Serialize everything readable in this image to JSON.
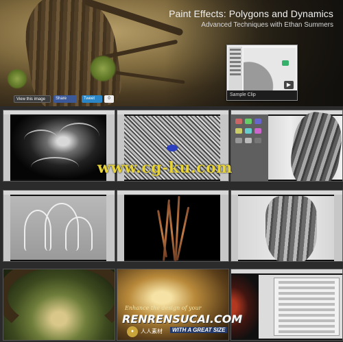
{
  "header": {
    "title": "Paint Effects: Polygons and Dynamics",
    "subtitle": "Advanced Techniques with Ethan Summers"
  },
  "sample": {
    "caption": "Sample Clip",
    "play_icon": "play-icon"
  },
  "social": {
    "view_image": "View this image",
    "share": "Share",
    "tweet": "Tweet",
    "count": "0"
  },
  "watermark": {
    "text": "www.cg-ku.com",
    "line1": "Enhance the design of your",
    "line2": "RENRENSUCAI.COM",
    "line3": "人人素材",
    "line4": "WITH A GREAT SIZE"
  },
  "colors": {
    "watermark_yellow": "#e6d23a",
    "facebook_blue": "#3b5998",
    "twitter_blue": "#2a86c6",
    "background": "#2b2b2b"
  }
}
